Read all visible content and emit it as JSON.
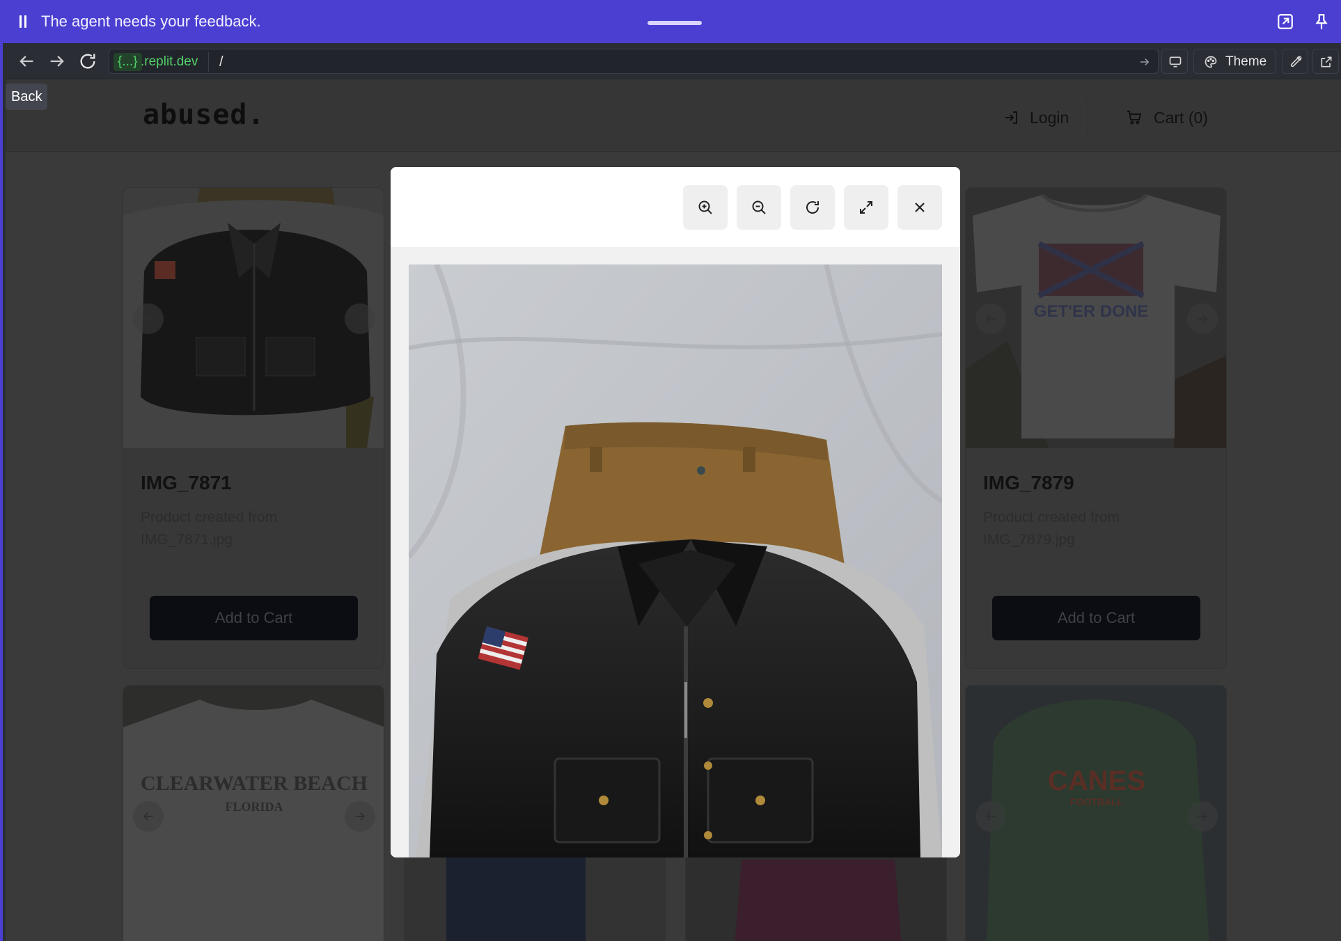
{
  "agent_bar": {
    "message": "The agent needs your feedback."
  },
  "browser": {
    "domain_chip": "{...}",
    "domain_rest": ".replit.dev",
    "path": "/",
    "theme_label": "Theme",
    "back_tooltip": "Back"
  },
  "site": {
    "logo": "abused.",
    "login_label": "Login",
    "cart_label": "Cart (0)"
  },
  "products": [
    {
      "title": "IMG_7871",
      "description": "Product created from IMG_7871.jpg",
      "button": "Add to Cart"
    },
    {
      "title": "IMG_7879",
      "description": "Product created from IMG_7879.jpg",
      "button": "Add to Cart"
    }
  ],
  "lower_cards": [
    {
      "print_text": "CLEARWATER BEACH",
      "print_sub": "FLORIDA"
    },
    {
      "print_text": "CANES",
      "print_sub": "FOOTBALL"
    }
  ],
  "shirt_print": "GET'ER DONE",
  "modal": {
    "tools": [
      "zoom-in",
      "zoom-out",
      "rotate",
      "fullscreen",
      "close"
    ]
  },
  "colors": {
    "agent_purple": "#4b3fd1",
    "url_green": "#52d26a",
    "button_dark": "#0b0d13"
  }
}
